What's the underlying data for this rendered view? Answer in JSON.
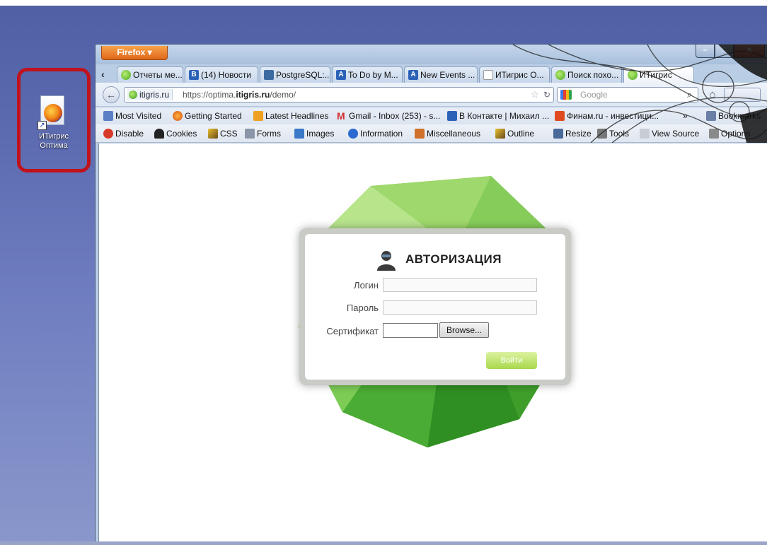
{
  "desktop": {
    "shortcut_label": "ИТигрис\nОптима",
    "highlight_color": "#c0121c"
  },
  "browser": {
    "firefox_button": "Firefox ▾",
    "tabs": [
      {
        "label": "Отчеты ме...",
        "icon": "green-globe-icon"
      },
      {
        "label": "(14) Новости",
        "icon": "vk-icon"
      },
      {
        "label": "PostgreSQL:...",
        "icon": "postgresql-icon"
      },
      {
        "label": "To Do by M...",
        "icon": "a-icon"
      },
      {
        "label": "New Events ...",
        "icon": "a-icon"
      },
      {
        "label": "ИТигрис О...",
        "icon": "blank-page-icon"
      },
      {
        "label": "Поиск похо...",
        "icon": "green-globe-icon"
      },
      {
        "label": "ИТигрис",
        "icon": "green-globe-icon"
      }
    ],
    "address": {
      "site": "itigris.ru",
      "url_prefix": "https://optima.",
      "url_domain": "itigris.ru",
      "url_suffix": "/demo/"
    },
    "search_placeholder": "Google",
    "bookmarks": [
      "Most Visited",
      "Getting Started",
      "Latest Headlines",
      "Gmail - Inbox (253) - s...",
      "В Контакте | Михаил ...",
      "Финам.ru - инвестици...",
      "Bookmarks"
    ],
    "bookmarks_more": "»",
    "dev_toolbar": [
      "Disable",
      "Cookies",
      "CSS",
      "Forms",
      "Images",
      "Information",
      "Miscellaneous",
      "Outline",
      "Resize",
      "Tools",
      "View Source",
      "Options"
    ]
  },
  "login": {
    "title": "АВТОРИЗАЦИЯ",
    "login_label": "Логин",
    "password_label": "Пароль",
    "certificate_label": "Сертификат",
    "browse_button": "Browse...",
    "submit_button": "Войти",
    "accent_color": "#a8d84c"
  }
}
